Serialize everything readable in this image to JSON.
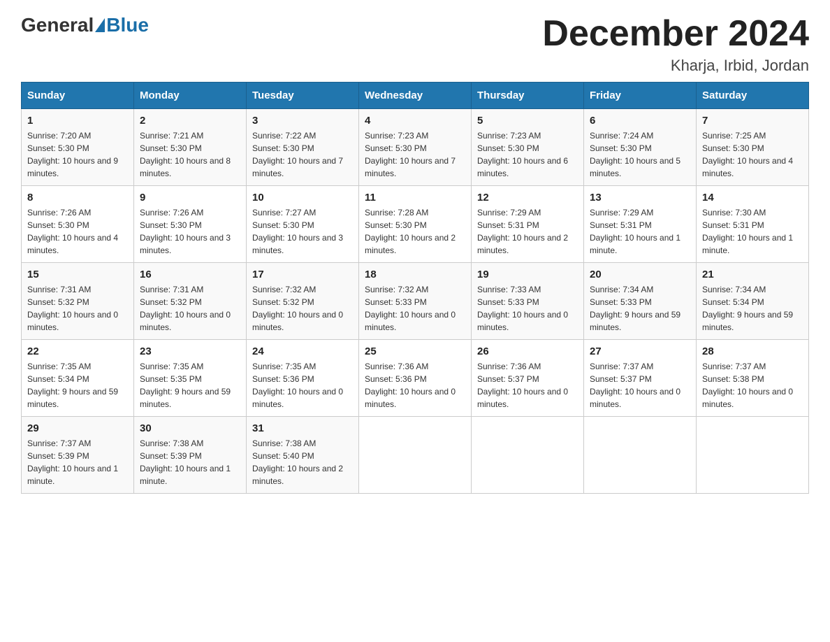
{
  "header": {
    "logo_general": "General",
    "logo_blue": "Blue",
    "month_year": "December 2024",
    "location": "Kharja, Irbid, Jordan"
  },
  "weekdays": [
    "Sunday",
    "Monday",
    "Tuesday",
    "Wednesday",
    "Thursday",
    "Friday",
    "Saturday"
  ],
  "weeks": [
    [
      {
        "day": "1",
        "sunrise": "7:20 AM",
        "sunset": "5:30 PM",
        "daylight": "10 hours and 9 minutes."
      },
      {
        "day": "2",
        "sunrise": "7:21 AM",
        "sunset": "5:30 PM",
        "daylight": "10 hours and 8 minutes."
      },
      {
        "day": "3",
        "sunrise": "7:22 AM",
        "sunset": "5:30 PM",
        "daylight": "10 hours and 7 minutes."
      },
      {
        "day": "4",
        "sunrise": "7:23 AM",
        "sunset": "5:30 PM",
        "daylight": "10 hours and 7 minutes."
      },
      {
        "day": "5",
        "sunrise": "7:23 AM",
        "sunset": "5:30 PM",
        "daylight": "10 hours and 6 minutes."
      },
      {
        "day": "6",
        "sunrise": "7:24 AM",
        "sunset": "5:30 PM",
        "daylight": "10 hours and 5 minutes."
      },
      {
        "day": "7",
        "sunrise": "7:25 AM",
        "sunset": "5:30 PM",
        "daylight": "10 hours and 4 minutes."
      }
    ],
    [
      {
        "day": "8",
        "sunrise": "7:26 AM",
        "sunset": "5:30 PM",
        "daylight": "10 hours and 4 minutes."
      },
      {
        "day": "9",
        "sunrise": "7:26 AM",
        "sunset": "5:30 PM",
        "daylight": "10 hours and 3 minutes."
      },
      {
        "day": "10",
        "sunrise": "7:27 AM",
        "sunset": "5:30 PM",
        "daylight": "10 hours and 3 minutes."
      },
      {
        "day": "11",
        "sunrise": "7:28 AM",
        "sunset": "5:30 PM",
        "daylight": "10 hours and 2 minutes."
      },
      {
        "day": "12",
        "sunrise": "7:29 AM",
        "sunset": "5:31 PM",
        "daylight": "10 hours and 2 minutes."
      },
      {
        "day": "13",
        "sunrise": "7:29 AM",
        "sunset": "5:31 PM",
        "daylight": "10 hours and 1 minute."
      },
      {
        "day": "14",
        "sunrise": "7:30 AM",
        "sunset": "5:31 PM",
        "daylight": "10 hours and 1 minute."
      }
    ],
    [
      {
        "day": "15",
        "sunrise": "7:31 AM",
        "sunset": "5:32 PM",
        "daylight": "10 hours and 0 minutes."
      },
      {
        "day": "16",
        "sunrise": "7:31 AM",
        "sunset": "5:32 PM",
        "daylight": "10 hours and 0 minutes."
      },
      {
        "day": "17",
        "sunrise": "7:32 AM",
        "sunset": "5:32 PM",
        "daylight": "10 hours and 0 minutes."
      },
      {
        "day": "18",
        "sunrise": "7:32 AM",
        "sunset": "5:33 PM",
        "daylight": "10 hours and 0 minutes."
      },
      {
        "day": "19",
        "sunrise": "7:33 AM",
        "sunset": "5:33 PM",
        "daylight": "10 hours and 0 minutes."
      },
      {
        "day": "20",
        "sunrise": "7:34 AM",
        "sunset": "5:33 PM",
        "daylight": "9 hours and 59 minutes."
      },
      {
        "day": "21",
        "sunrise": "7:34 AM",
        "sunset": "5:34 PM",
        "daylight": "9 hours and 59 minutes."
      }
    ],
    [
      {
        "day": "22",
        "sunrise": "7:35 AM",
        "sunset": "5:34 PM",
        "daylight": "9 hours and 59 minutes."
      },
      {
        "day": "23",
        "sunrise": "7:35 AM",
        "sunset": "5:35 PM",
        "daylight": "9 hours and 59 minutes."
      },
      {
        "day": "24",
        "sunrise": "7:35 AM",
        "sunset": "5:36 PM",
        "daylight": "10 hours and 0 minutes."
      },
      {
        "day": "25",
        "sunrise": "7:36 AM",
        "sunset": "5:36 PM",
        "daylight": "10 hours and 0 minutes."
      },
      {
        "day": "26",
        "sunrise": "7:36 AM",
        "sunset": "5:37 PM",
        "daylight": "10 hours and 0 minutes."
      },
      {
        "day": "27",
        "sunrise": "7:37 AM",
        "sunset": "5:37 PM",
        "daylight": "10 hours and 0 minutes."
      },
      {
        "day": "28",
        "sunrise": "7:37 AM",
        "sunset": "5:38 PM",
        "daylight": "10 hours and 0 minutes."
      }
    ],
    [
      {
        "day": "29",
        "sunrise": "7:37 AM",
        "sunset": "5:39 PM",
        "daylight": "10 hours and 1 minute."
      },
      {
        "day": "30",
        "sunrise": "7:38 AM",
        "sunset": "5:39 PM",
        "daylight": "10 hours and 1 minute."
      },
      {
        "day": "31",
        "sunrise": "7:38 AM",
        "sunset": "5:40 PM",
        "daylight": "10 hours and 2 minutes."
      },
      null,
      null,
      null,
      null
    ]
  ],
  "labels": {
    "sunrise": "Sunrise:",
    "sunset": "Sunset:",
    "daylight": "Daylight:"
  }
}
